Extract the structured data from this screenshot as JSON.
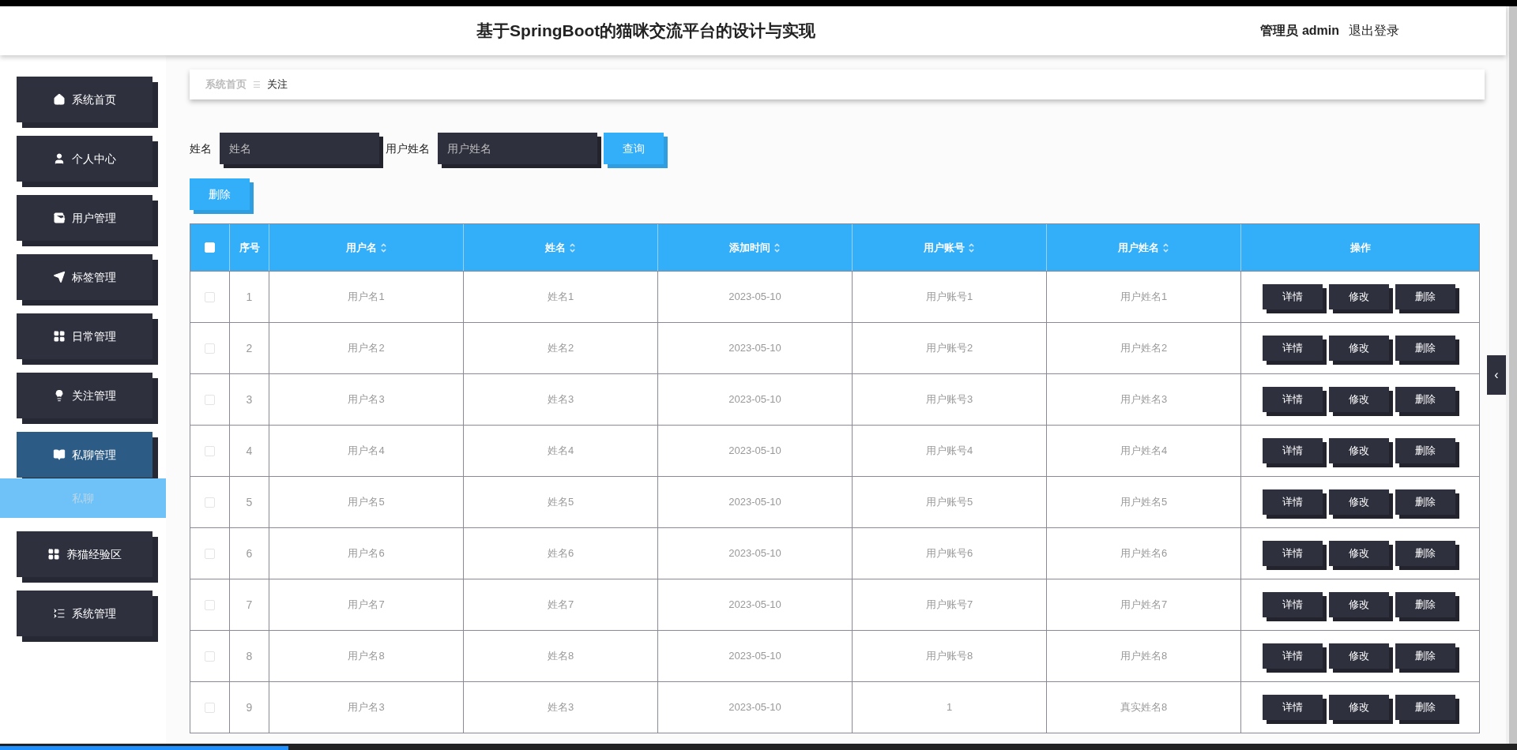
{
  "header": {
    "title": "基于SpringBoot的猫咪交流平台的设计与实现",
    "user_role": "管理员",
    "user_name": "admin",
    "logout": "退出登录"
  },
  "sidebar": {
    "items": [
      {
        "label": "系统首页",
        "expanded": false
      },
      {
        "label": "个人中心",
        "expanded": false
      },
      {
        "label": "用户管理",
        "expanded": false
      },
      {
        "label": "标签管理",
        "expanded": false
      },
      {
        "label": "日常管理",
        "expanded": false
      },
      {
        "label": "关注管理",
        "expanded": false
      },
      {
        "label": "私聊管理",
        "expanded": true,
        "children": [
          {
            "label": "私聊",
            "selected": true
          }
        ]
      },
      {
        "label": "养猫经验区",
        "expanded": false
      },
      {
        "label": "系统管理",
        "expanded": false
      }
    ]
  },
  "breadcrumb": {
    "items": [
      "系统首页",
      "关注"
    ],
    "separator": "☰"
  },
  "search": {
    "fields": [
      {
        "label": "姓名",
        "placeholder": "姓名"
      },
      {
        "label": "用户姓名",
        "placeholder": "用户姓名"
      }
    ],
    "button": "查询"
  },
  "delete_button": "删除",
  "table": {
    "select_all_checked": false,
    "columns": [
      {
        "label": "序号",
        "sortable": false
      },
      {
        "label": "用户名",
        "sortable": true
      },
      {
        "label": "姓名",
        "sortable": true
      },
      {
        "label": "添加时间",
        "sortable": true
      },
      {
        "label": "用户账号",
        "sortable": true
      },
      {
        "label": "用户姓名",
        "sortable": true
      },
      {
        "label": "操作",
        "sortable": false
      }
    ],
    "rows": [
      {
        "checked": false,
        "cells": [
          "1",
          "用户名1",
          "姓名1",
          "2023-05-10",
          "用户账号1",
          "用户姓名1"
        ],
        "actions": [
          "详情",
          "修改",
          "删除"
        ]
      },
      {
        "checked": false,
        "cells": [
          "2",
          "用户名2",
          "姓名2",
          "2023-05-10",
          "用户账号2",
          "用户姓名2"
        ],
        "actions": [
          "详情",
          "修改",
          "删除"
        ]
      },
      {
        "checked": false,
        "cells": [
          "3",
          "用户名3",
          "姓名3",
          "2023-05-10",
          "用户账号3",
          "用户姓名3"
        ],
        "actions": [
          "详情",
          "修改",
          "删除"
        ]
      },
      {
        "checked": false,
        "cells": [
          "4",
          "用户名4",
          "姓名4",
          "2023-05-10",
          "用户账号4",
          "用户姓名4"
        ],
        "actions": [
          "详情",
          "修改",
          "删除"
        ]
      },
      {
        "checked": false,
        "cells": [
          "5",
          "用户名5",
          "姓名5",
          "2023-05-10",
          "用户账号5",
          "用户姓名5"
        ],
        "actions": [
          "详情",
          "修改",
          "删除"
        ]
      },
      {
        "checked": false,
        "cells": [
          "6",
          "用户名6",
          "姓名6",
          "2023-05-10",
          "用户账号6",
          "用户姓名6"
        ],
        "actions": [
          "详情",
          "修改",
          "删除"
        ]
      },
      {
        "checked": false,
        "cells": [
          "7",
          "用户名7",
          "姓名7",
          "2023-05-10",
          "用户账号7",
          "用户姓名7"
        ],
        "actions": [
          "详情",
          "修改",
          "删除"
        ]
      },
      {
        "checked": false,
        "cells": [
          "8",
          "用户名8",
          "姓名8",
          "2023-05-10",
          "用户账号8",
          "用户姓名8"
        ],
        "actions": [
          "详情",
          "修改",
          "删除"
        ]
      },
      {
        "checked": false,
        "cells": [
          "9",
          "用户名3",
          "姓名3",
          "2023-05-10",
          "1",
          "真实姓名8"
        ],
        "actions": [
          "详情",
          "修改",
          "删除"
        ]
      }
    ]
  },
  "side_tab": {
    "glyph": "‹"
  },
  "playback": {
    "level": 0.19
  }
}
